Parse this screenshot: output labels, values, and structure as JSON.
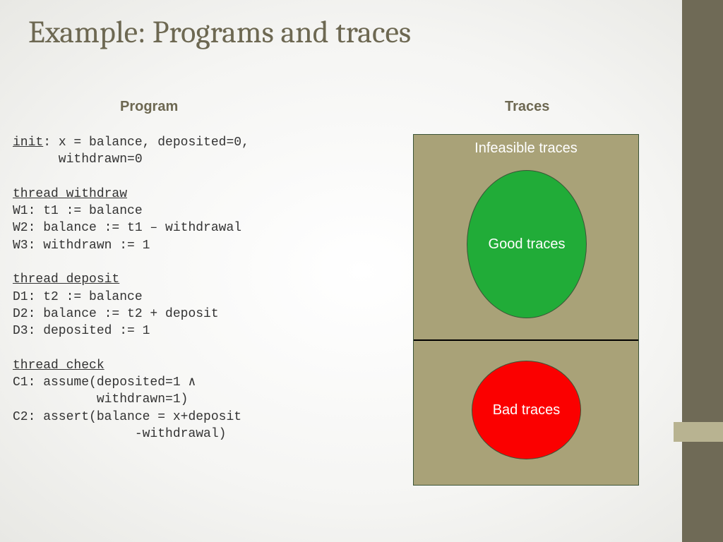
{
  "title": "Example: Programs and traces",
  "columns": {
    "program": "Program",
    "traces": "Traces"
  },
  "code": {
    "init_key": "init",
    "init_rest": ": x = balance, deposited=0,\n      withdrawn=0",
    "tw_head": "thread_withdraw",
    "tw_body": "W1: t1 := balance\nW2: balance := t1 – withdrawal\nW3: withdrawn := 1",
    "td_head": "thread_deposit",
    "td_body": "D1: t2 := balance\nD2: balance := t2 + deposit\nD3: deposited := 1",
    "tc_head": "thread_check",
    "tc_body": "C1: assume(deposited=1 ∧\n           withdrawn=1)\nC2: assert(balance = x+deposit\n                -withdrawal)"
  },
  "traces": {
    "box_label": "Infeasible traces",
    "good": "Good\ntraces",
    "bad": "Bad\ntraces"
  }
}
